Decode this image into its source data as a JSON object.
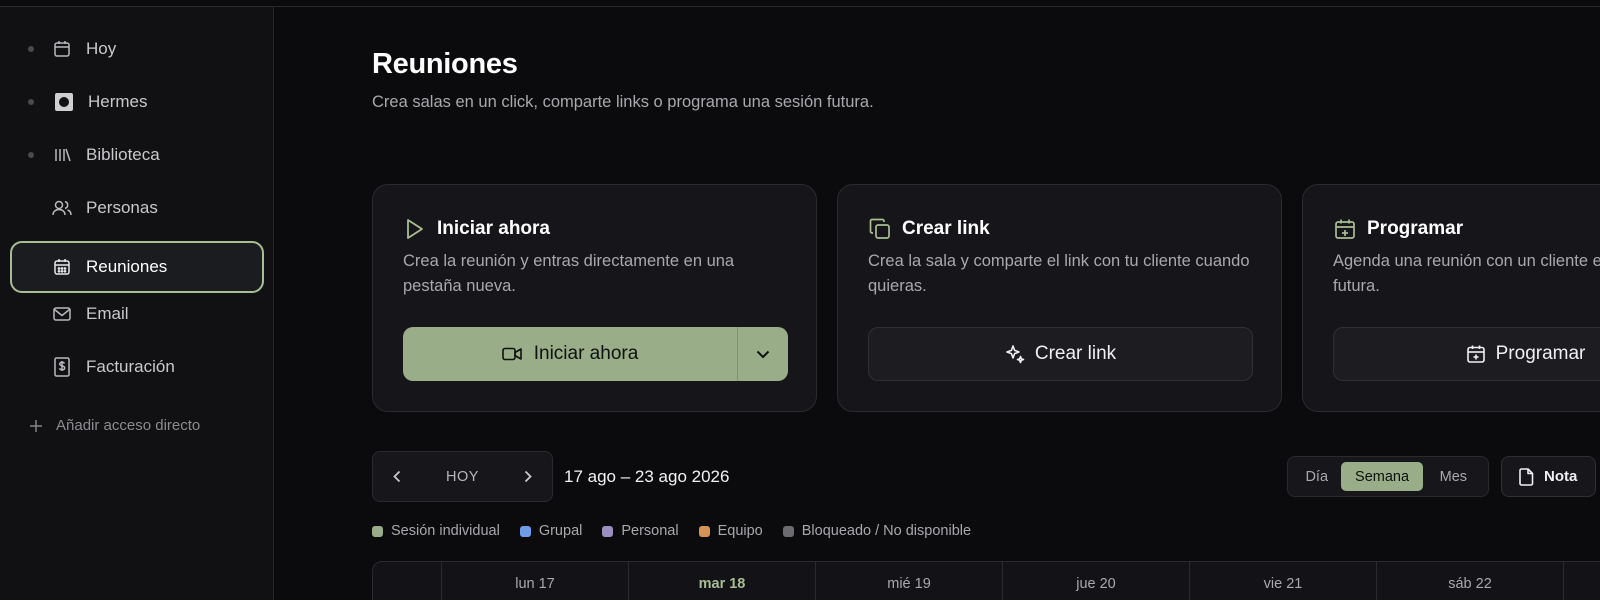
{
  "sidebar": {
    "items": [
      {
        "label": "Hoy",
        "icon": "calendar-icon",
        "dot": true
      },
      {
        "label": "Hermes",
        "icon": "hermes-logo-icon",
        "dot": true
      },
      {
        "label": "Biblioteca",
        "icon": "library-icon",
        "dot": true
      },
      {
        "label": "Personas",
        "icon": "users-icon",
        "dot": false
      },
      {
        "label": "Reuniones",
        "icon": "calendar-grid-icon",
        "dot": false,
        "active": true
      },
      {
        "label": "Email",
        "icon": "mail-icon",
        "dot": false
      },
      {
        "label": "Facturación",
        "icon": "invoice-icon",
        "dot": false
      }
    ],
    "add_shortcut": "Añadir acceso directo"
  },
  "main": {
    "title": "Reuniones",
    "subtitle": "Crea salas en un click, comparte links o programa una sesión futura."
  },
  "cards": [
    {
      "title": "Iniciar ahora",
      "icon": "play-icon",
      "description": "Crea la reunión y entras directamente en una pestaña nueva.",
      "button": "Iniciar ahora",
      "button_icon": "video-icon"
    },
    {
      "title": "Crear link",
      "icon": "copy-icon",
      "description": "Crea la sala y comparte el link con tu cliente cuando quieras.",
      "button": "Crear link",
      "button_icon": "sparkle-icon"
    },
    {
      "title": "Programar",
      "icon": "calendar-plus-icon",
      "description": "Agenda una reunión con un cliente en una fecha futura.",
      "button": "Programar",
      "button_icon": "calendar-plus-icon"
    }
  ],
  "toolbar": {
    "today": "HOY",
    "date_range": "17 ago – 23 ago 2026",
    "views": [
      "Día",
      "Semana",
      "Mes"
    ],
    "active_view": "Semana",
    "note": "Nota"
  },
  "legend": [
    {
      "label": "Sesión individual",
      "color": "#98ad88"
    },
    {
      "label": "Grupal",
      "color": "#6f9be8"
    },
    {
      "label": "Personal",
      "color": "#9a8fc0"
    },
    {
      "label": "Equipo",
      "color": "#d49455"
    },
    {
      "label": "Bloqueado / No disponible",
      "color": "#6b6b70"
    }
  ],
  "calendar": {
    "days": [
      "lun 17",
      "mar 18",
      "mié 19",
      "jue 20",
      "vie 21",
      "sáb 22"
    ],
    "today_index": 1
  },
  "colors": {
    "accent": "#98ad88",
    "background": "#0b0b0d",
    "sidebar": "#111114",
    "card": "#16161a"
  }
}
